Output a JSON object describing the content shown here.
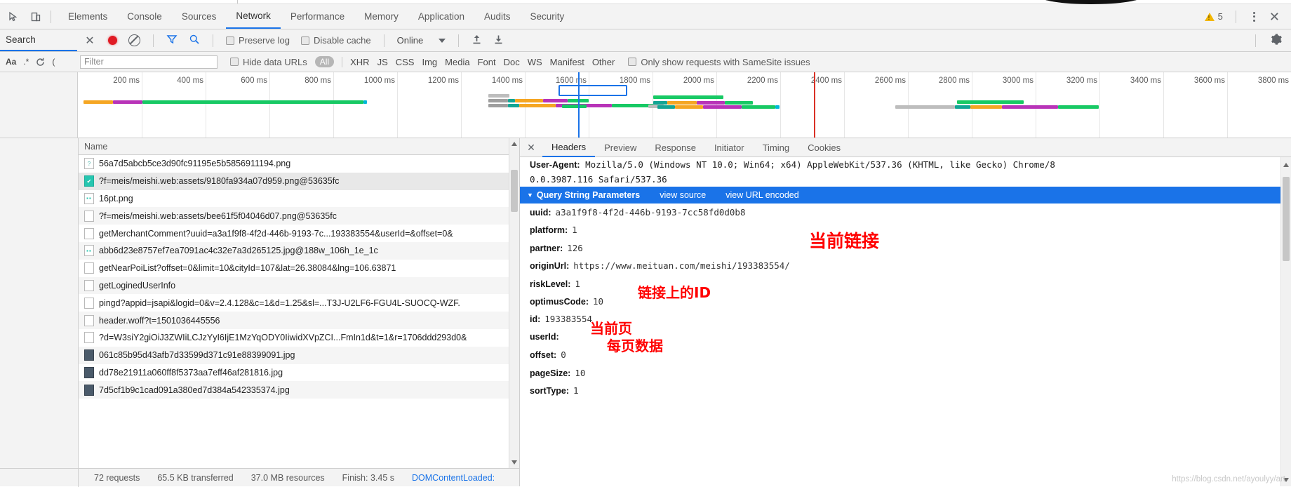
{
  "window": {
    "warning_count": "5",
    "close_label": "✕"
  },
  "menubar": {
    "icons": [
      {
        "name": "inspect-element-icon",
        "glyph": "cursor"
      },
      {
        "name": "device-toolbar-icon",
        "glyph": "device"
      }
    ],
    "tabs": [
      {
        "label": "Elements",
        "active": false
      },
      {
        "label": "Console",
        "active": false
      },
      {
        "label": "Sources",
        "active": false
      },
      {
        "label": "Network",
        "active": true
      },
      {
        "label": "Performance",
        "active": false
      },
      {
        "label": "Memory",
        "active": false
      },
      {
        "label": "Application",
        "active": false
      },
      {
        "label": "Audits",
        "active": false
      },
      {
        "label": "Security",
        "active": false
      }
    ]
  },
  "network_toolbar": {
    "search_tab_label": "Search",
    "search_close_label": "✕",
    "record_icon": "record-dot-icon",
    "clear_icon": "clear-ban-icon",
    "filter_icon": "funnel-icon",
    "search_icon": "magnifier-icon",
    "preserve_log_label": "Preserve log",
    "preserve_log_checked": false,
    "disable_cache_label": "Disable cache",
    "disable_cache_checked": false,
    "throttling_value": "Online",
    "import_icon": "upload-arrow-icon",
    "export_icon": "download-arrow-icon",
    "settings_icon": "gear-icon"
  },
  "filter_bar": {
    "match_case_label": "Aa",
    "regex_label": ".*",
    "refresh_icon": "refresh-icon",
    "extra_icon": "paren-icon",
    "filter_placeholder": "Filter",
    "filter_value": "",
    "hide_data_urls_label": "Hide data URLs",
    "hide_data_urls_checked": false,
    "types": [
      "All",
      "XHR",
      "JS",
      "CSS",
      "Img",
      "Media",
      "Font",
      "Doc",
      "WS",
      "Manifest",
      "Other"
    ],
    "active_type": "All",
    "samesite_label": "Only show requests with SameSite issues",
    "samesite_checked": false
  },
  "overview": {
    "ticks": [
      "200 ms",
      "400 ms",
      "600 ms",
      "800 ms",
      "1000 ms",
      "1200 ms",
      "1400 ms",
      "1600 ms",
      "1800 ms",
      "2000 ms",
      "2200 ms",
      "2400 ms",
      "2600 ms",
      "2800 ms",
      "3000 ms",
      "3200 ms",
      "3400 ms",
      "3600 ms",
      "3800 ms"
    ],
    "dcl_event_color": "#1a73e8",
    "load_event_color": "#d93025",
    "colors": {
      "queue": "#bdbdbd",
      "stalled": "#9e9e9e",
      "dns": "#12a594",
      "request": "#f5a623",
      "response": "#b833b8",
      "download": "#17c964",
      "teal": "#00b8d9"
    }
  },
  "requests": {
    "column_header": "Name",
    "rows": [
      {
        "name": "56a7d5abcb5ce3d90fc91195e5b5856911194.png",
        "icon": "image-placeholder-icon",
        "selected": false
      },
      {
        "name": "?f=meis/meishi.web:assets/9180fa934a07d959.png@53635fc",
        "icon": "image-ok-icon",
        "selected": true
      },
      {
        "name": "16pt.png",
        "icon": "image-small-icon",
        "selected": false
      },
      {
        "name": "?f=meis/meishi.web:assets/bee61f5f04046d07.png@53635fc",
        "icon": "doc-icon",
        "selected": false
      },
      {
        "name": "getMerchantComment?uuid=a3a1f9f8-4f2d-446b-9193-7c...193383554&userId=&offset=0&",
        "icon": "doc-icon",
        "selected": false
      },
      {
        "name": "abb6d23e8757ef7ea7091ac4c32e7a3d265125.jpg@188w_106h_1e_1c",
        "icon": "image-small-icon",
        "selected": false
      },
      {
        "name": "getNearPoiList?offset=0&limit=10&cityId=107&lat=26.38084&lng=106.63871",
        "icon": "doc-icon",
        "selected": false
      },
      {
        "name": "getLoginedUserInfo",
        "icon": "doc-icon",
        "selected": false
      },
      {
        "name": "pingd?appid=jsapi&logid=0&v=2.4.128&c=1&d=1.25&sl=...T3J-U2LF6-FGU4L-SUOCQ-WZF.",
        "icon": "doc-icon",
        "selected": false
      },
      {
        "name": "header.woff?t=1501036445556",
        "icon": "doc-icon",
        "selected": false
      },
      {
        "name": "?d=W3siY2giOiJ3ZWIiLCJzYyI6IjE1MzYqODY0IiwidXVpZCI...FmIn1d&t=1&r=1706ddd293d0&",
        "icon": "doc-icon",
        "selected": false
      },
      {
        "name": "061c85b95d43afb7d33599d371c91e88399091.jpg",
        "icon": "image-dark-icon",
        "selected": false
      },
      {
        "name": "dd78e21911a060ff8f5373aa7eff46af281816.jpg",
        "icon": "image-dark-icon",
        "selected": false
      },
      {
        "name": "7d5cf1b9c1cad091a380ed7d384a542335374.jpg",
        "icon": "image-dark-icon",
        "selected": false
      }
    ]
  },
  "status_bar": {
    "requests": "72 requests",
    "transferred": "65.5 KB transferred",
    "resources": "37.0 MB resources",
    "finish": "Finish: 3.45 s",
    "dom_content_loaded": "DOMContentLoaded:"
  },
  "details": {
    "close_label": "✕",
    "tabs": [
      {
        "label": "Headers",
        "active": true
      },
      {
        "label": "Preview",
        "active": false
      },
      {
        "label": "Response",
        "active": false
      },
      {
        "label": "Initiator",
        "active": false
      },
      {
        "label": "Timing",
        "active": false
      },
      {
        "label": "Cookies",
        "active": false
      }
    ],
    "user_agent_key": "User-Agent:",
    "user_agent_line1": " Mozilla/5.0 (Windows NT 10.0; Win64; x64) AppleWebKit/537.36 (KHTML, like Gecko) Chrome/8",
    "user_agent_line2": "0.0.3987.116 Safari/537.36",
    "qsp_title": "Query String Parameters",
    "qsp_triangle": "▼",
    "view_source_label": "view source",
    "view_url_encoded_label": "view URL encoded",
    "params": [
      {
        "key": "uuid:",
        "value": "a3a1f9f8-4f2d-446b-9193-7cc58fd0d0b8"
      },
      {
        "key": "platform:",
        "value": "1"
      },
      {
        "key": "partner:",
        "value": "126"
      },
      {
        "key": "originUrl:",
        "value": "https://www.meituan.com/meishi/193383554/"
      },
      {
        "key": "riskLevel:",
        "value": "1"
      },
      {
        "key": "optimusCode:",
        "value": "10"
      },
      {
        "key": "id:",
        "value": "193383554"
      },
      {
        "key": "userId:",
        "value": ""
      },
      {
        "key": "offset:",
        "value": "0"
      },
      {
        "key": "pageSize:",
        "value": "10"
      },
      {
        "key": "sortType:",
        "value": "1"
      }
    ]
  },
  "annotations": [
    {
      "text": "当前链接",
      "name": "annotation-current-link"
    },
    {
      "text": "链接上的ID",
      "name": "annotation-id-on-link"
    },
    {
      "text": "当前页",
      "name": "annotation-current-page"
    },
    {
      "text": "每页数据",
      "name": "annotation-page-size"
    }
  ],
  "watermark": {
    "text": "https://blog.csdn.net/ayoulyy/art"
  }
}
